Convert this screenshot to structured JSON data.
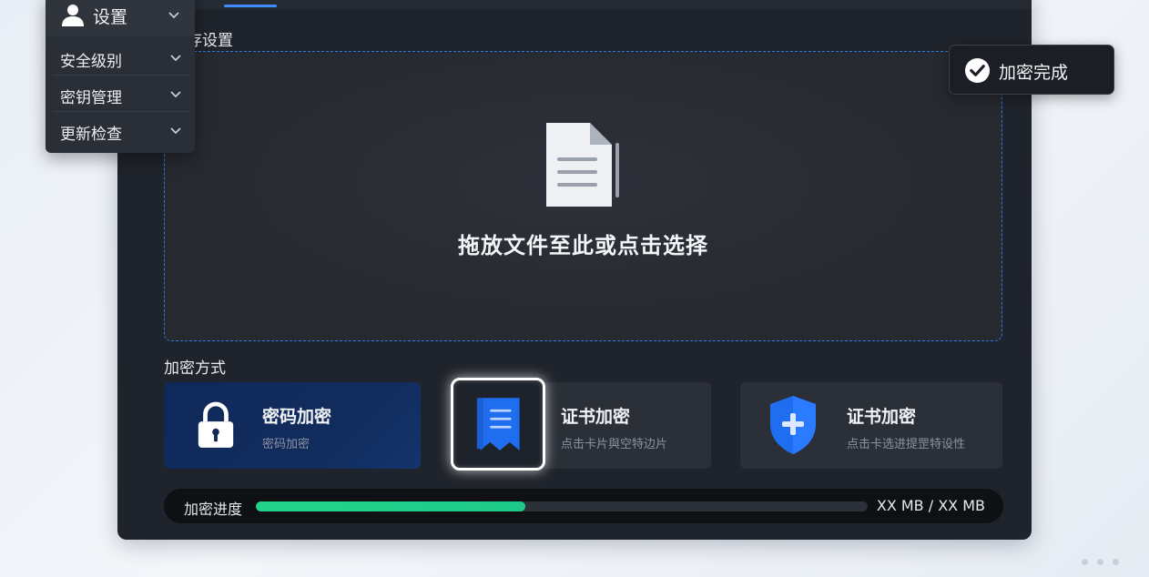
{
  "menu": {
    "header_label": "设置",
    "items": [
      {
        "label": "安全级别"
      },
      {
        "label": "密钥管理"
      },
      {
        "label": "更新检查"
      }
    ]
  },
  "main": {
    "section_title": "存设置",
    "dropzone_text": "拖放文件至此或点击选择",
    "method_title": "加密方式",
    "methods": [
      {
        "title": "密码加密",
        "subtitle": "密码加密",
        "icon": "lock-icon"
      },
      {
        "title": "证书加密",
        "subtitle": "点击卡片與空特边片",
        "icon": "certificate-icon"
      },
      {
        "title": "证书加密",
        "subtitle": "点击卡选进提罡特设性",
        "icon": "shield-plus-icon"
      }
    ],
    "progress": {
      "label": "加密进度",
      "size_text": "XX MB / XX MB",
      "fraction": 0.44
    }
  },
  "toast": {
    "label": "加密完成"
  },
  "colors": {
    "accent": "#3f8cff",
    "progress": "#22d38a",
    "window_bg": "#1f232b",
    "active_card": "#0f2a5a"
  }
}
